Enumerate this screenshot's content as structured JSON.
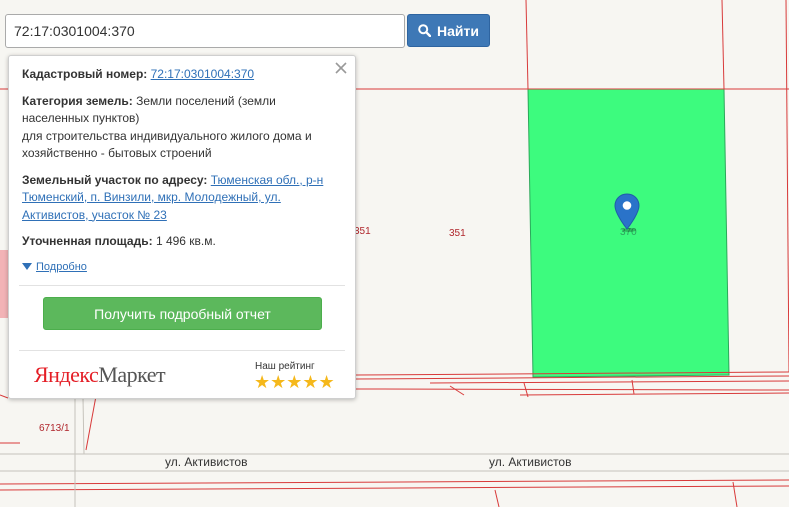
{
  "search": {
    "value": "72:17:0301004:370",
    "button_label": "Найти"
  },
  "popup": {
    "cadastral_label": "Кадастровый номер:",
    "cadastral_value": "72:17:0301004:370",
    "category_label": "Категория земель:",
    "category_value": "Земли поселений (земли населенных пунктов)",
    "purpose": "для строительства индивидуального жилого дома и хозяйственно - бытовых строений",
    "address_label": "Земельный участок по адресу:",
    "address_value": "Тюменская обл., р-н Тюменский, п. Винзили, мкр. Молодежный, ул. Активистов, участок № 23",
    "area_label": "Уточненная площадь:",
    "area_value": "1 496 кв.м.",
    "more_link": "Подробно",
    "report_button": "Получить подробный отчет",
    "brand_yandex": "Яндекс",
    "brand_market": "Маркет",
    "rating_label": "Наш рейтинг",
    "rating_stars": "★★★★★"
  },
  "map": {
    "parcel_labels": {
      "p351a": "351",
      "p351b": "351",
      "p370": "370",
      "p6713": "6713/1"
    },
    "streets": {
      "west": "ул. Активистов",
      "east": "ул. Активистов"
    },
    "colors": {
      "selected_parcel": "#3dfb7e",
      "boundary": "#d83a3a",
      "pin": "#2a73c9"
    }
  }
}
